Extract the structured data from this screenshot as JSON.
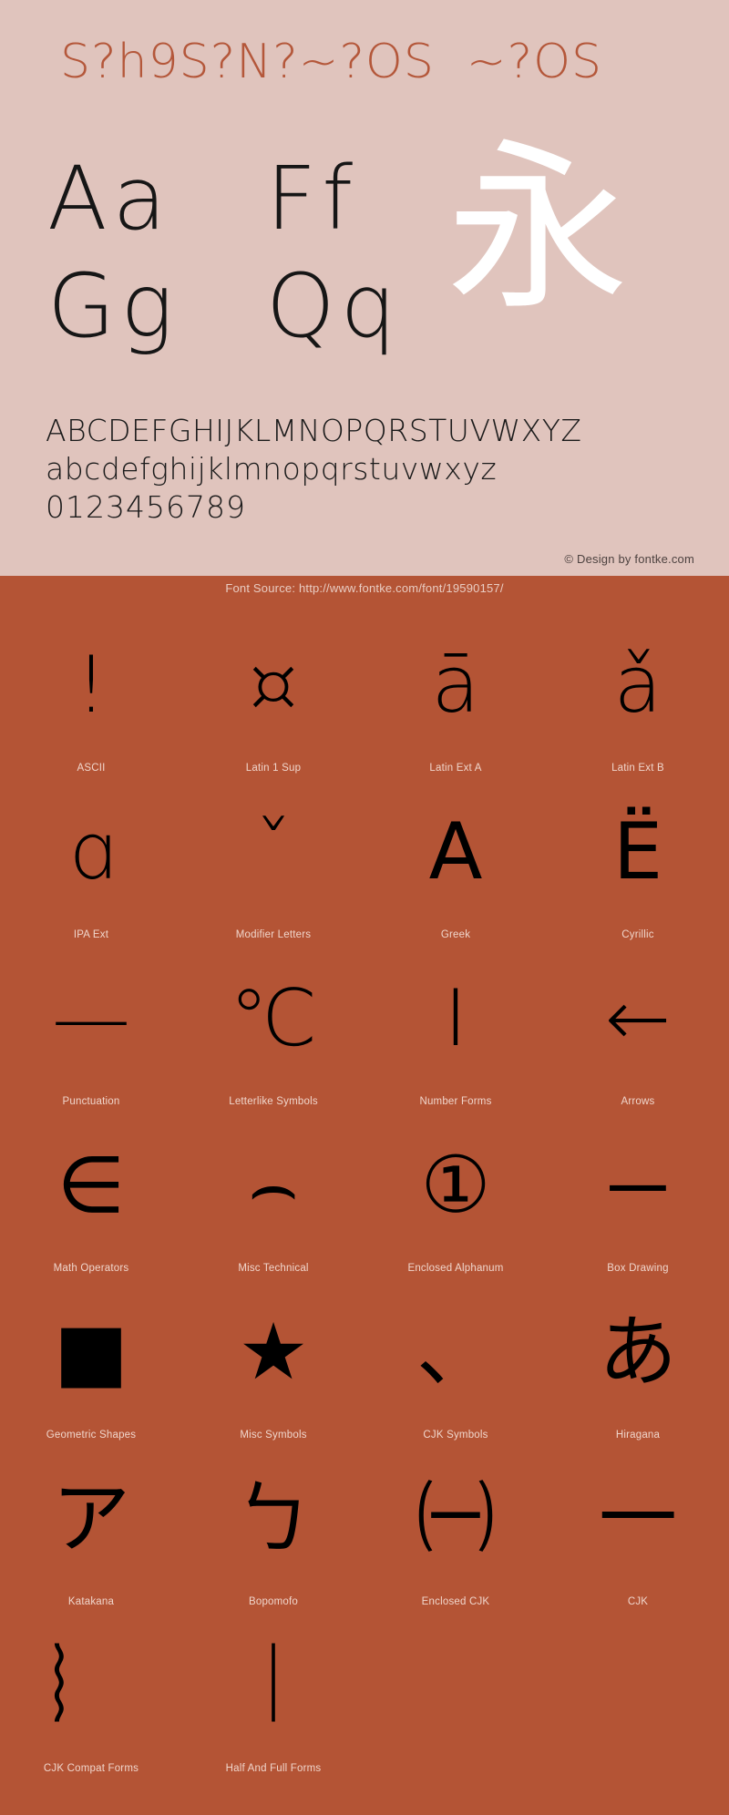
{
  "specimen": {
    "title": "S?h9S?N?~?OS  ~?OS",
    "sample_pairs": [
      "Aa",
      "Ff",
      "Gg",
      "Qq"
    ],
    "cjk_sample": "永",
    "uppercase": "ABCDEFGHIJKLMNOPQRSTUVWXYZ",
    "lowercase": "abcdefghijklmnopqrstuvwxyz",
    "digits": "0123456789",
    "copyright": "© Design by fontke.com",
    "colors": {
      "panel_bg": "#e0c4bd",
      "title_color": "#b4573a",
      "glyph_color": "#161616",
      "cjk_color": "#ffffff"
    }
  },
  "source_bar": {
    "text": "Font Source: http://www.fontke.com/font/19590157/",
    "colors": {
      "bg": "#b45435",
      "fg": "#e9ccc2"
    }
  },
  "blocks": {
    "rows": [
      [
        {
          "label": "ASCII",
          "glyph": "!",
          "weight": "light"
        },
        {
          "label": "Latin 1 Sup",
          "glyph": "¤",
          "weight": "light"
        },
        {
          "label": "Latin Ext A",
          "glyph": "ā",
          "weight": "light"
        },
        {
          "label": "Latin Ext B",
          "glyph": "ǎ",
          "weight": "light"
        }
      ],
      [
        {
          "label": "IPA Ext",
          "glyph": "ɑ",
          "weight": "light"
        },
        {
          "label": "Modifier Letters",
          "glyph": "ˇ",
          "weight": "light"
        },
        {
          "label": "Greek",
          "glyph": "Α",
          "weight": "heavy"
        },
        {
          "label": "Cyrillic",
          "glyph": "Ё",
          "weight": "heavy"
        }
      ],
      [
        {
          "label": "Punctuation",
          "glyph": "—",
          "weight": "light"
        },
        {
          "label": "Letterlike Symbols",
          "glyph": "℃",
          "weight": "light"
        },
        {
          "label": "Number Forms",
          "glyph": "Ⅰ",
          "weight": "light"
        },
        {
          "label": "Arrows",
          "glyph": "←",
          "weight": "light"
        }
      ],
      [
        {
          "label": "Math Operators",
          "glyph": "∈",
          "weight": "light"
        },
        {
          "label": "Misc Technical",
          "glyph": "⌢",
          "weight": "light"
        },
        {
          "label": "Enclosed Alphanum",
          "glyph": "①",
          "weight": "light"
        },
        {
          "label": "Box Drawing",
          "glyph": "─",
          "weight": "light"
        }
      ],
      [
        {
          "label": "Geometric Shapes",
          "glyph": "■",
          "weight": "heavy"
        },
        {
          "label": "Misc Symbols",
          "glyph": "★",
          "weight": "heavy"
        },
        {
          "label": "CJK Symbols",
          "glyph": "、",
          "weight": "light"
        },
        {
          "label": "Hiragana",
          "glyph": "あ",
          "weight": "heavy"
        }
      ],
      [
        {
          "label": "Katakana",
          "glyph": "ア",
          "weight": "heavy"
        },
        {
          "label": "Bopomofo",
          "glyph": "ㄅ",
          "weight": "heavy"
        },
        {
          "label": "Enclosed CJK",
          "glyph": "㈠",
          "weight": "light"
        },
        {
          "label": "CJK",
          "glyph": "一",
          "weight": "light"
        }
      ],
      [
        {
          "label": "CJK Compat Forms",
          "glyph": "︴",
          "weight": "light"
        },
        {
          "label": "Half And Full Forms",
          "glyph": "｜",
          "weight": "light"
        }
      ]
    ]
  }
}
